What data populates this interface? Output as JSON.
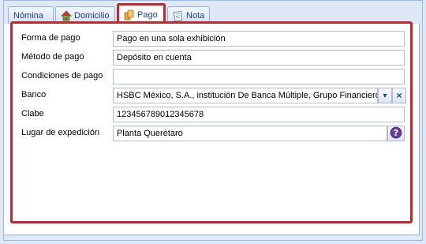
{
  "tabs": [
    {
      "label": "Nómina",
      "icon": "none"
    },
    {
      "label": "Domicilio",
      "icon": "house-icon"
    },
    {
      "label": "Pago",
      "icon": "payment-icon"
    },
    {
      "label": "Nota",
      "icon": "note-icon"
    }
  ],
  "active_tab": "Pago",
  "form": {
    "forma_pago": {
      "label": "Forma de pago",
      "value": "Pago en una sola exhibición"
    },
    "metodo_pago": {
      "label": "Método de pago",
      "value": "Depósito en cuenta"
    },
    "condiciones_pago": {
      "label": "Condiciones de pago",
      "value": ""
    },
    "banco": {
      "label": "Banco",
      "value": "HSBC México, S.A., institución De Banca Múltiple, Grupo Financiero..."
    },
    "clabe": {
      "label": "Clabe",
      "value": "123456789012345678"
    },
    "lugar_expedicion": {
      "label": "Lugar de expedición",
      "value": "Planta Querétaro"
    }
  },
  "colors": {
    "highlight": "#c1272d",
    "border": "#8db2e3",
    "text": "#15428b"
  }
}
